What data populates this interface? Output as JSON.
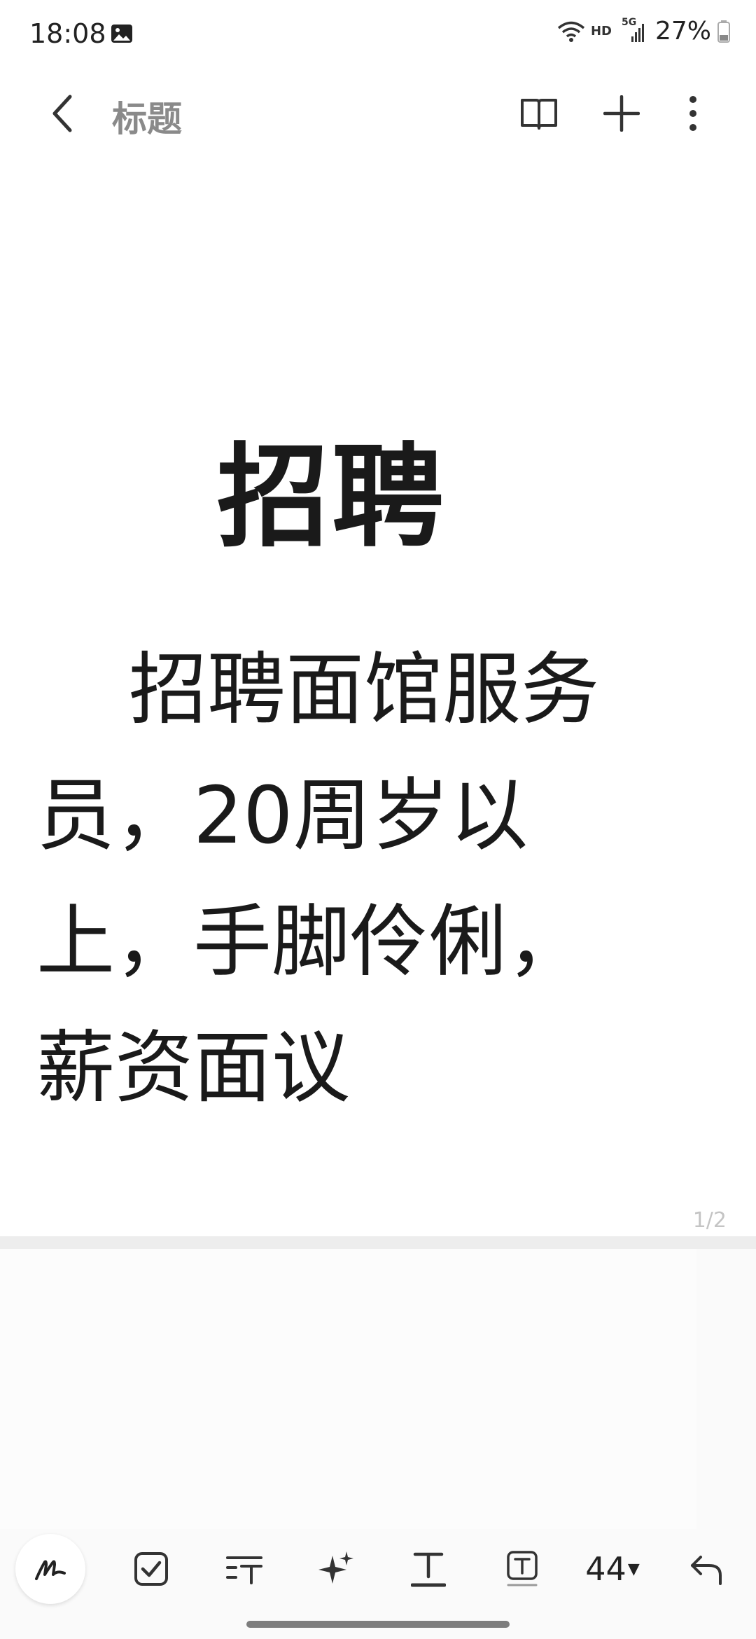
{
  "status_bar": {
    "time": "18:08",
    "gallery_icon": "image-icon",
    "network_label": "HD",
    "signal_label": "5G",
    "battery_text": "27%"
  },
  "app_bar": {
    "back_icon": "chevron-left-icon",
    "title": "标题",
    "reader_icon": "book-open-icon",
    "add_icon": "plus-icon",
    "more_icon": "more-vertical-icon"
  },
  "note": {
    "heading": "招聘",
    "body_lines": [
      "招聘面馆服务",
      "员，20周岁以",
      "上，手脚伶俐，",
      "薪资面议"
    ],
    "page_indicator": "1/2"
  },
  "toolbar": {
    "pen_icon": "pen-icon",
    "checkbox_icon": "checkbox-icon",
    "text_style_icon": "text-style-icon",
    "ai_icon": "sparkle-icon",
    "text_format_icon": "text-underline-icon",
    "textbox_icon": "textbox-icon",
    "font_size": "44",
    "undo_icon": "undo-icon"
  },
  "colors": {
    "text": "#1a1a1a",
    "title_gray": "#8a8a8a",
    "page_bg": "#ffffff",
    "surface_bg": "#fafafa"
  }
}
